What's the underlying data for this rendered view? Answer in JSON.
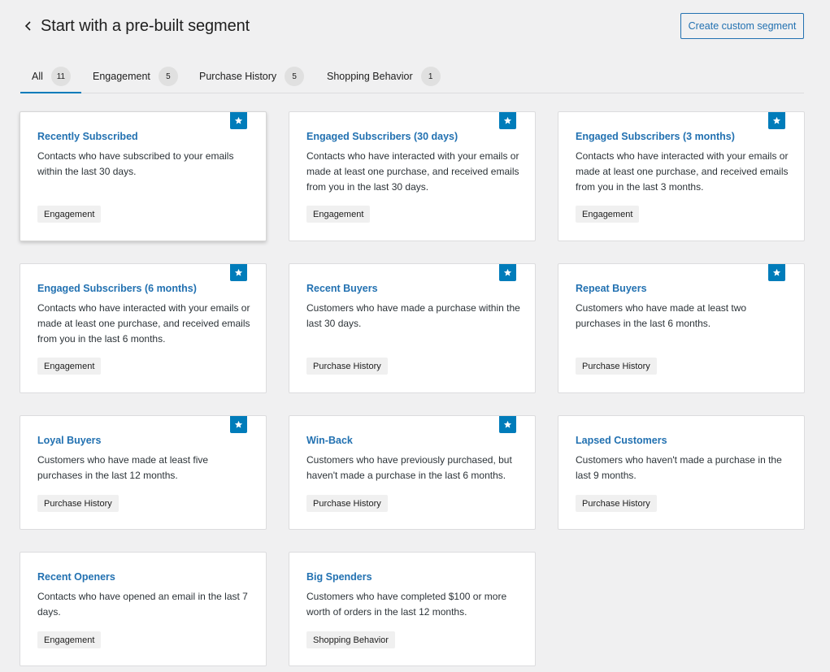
{
  "header": {
    "back_icon": "chevron-left-icon",
    "title": "Start with a pre-built segment",
    "create_button_label": "Create custom segment"
  },
  "tabs": [
    {
      "label": "All",
      "count": "11",
      "active": true
    },
    {
      "label": "Engagement",
      "count": "5",
      "active": false
    },
    {
      "label": "Purchase History",
      "count": "5",
      "active": false
    },
    {
      "label": "Shopping Behavior",
      "count": "1",
      "active": false
    }
  ],
  "colors": {
    "accent": "#007cba",
    "link": "#2271b1",
    "background": "#f0f0f1"
  },
  "segments": [
    {
      "title": "Recently Subscribed",
      "description": "Contacts who have subscribed to your emails within the last 30 days.",
      "tag": "Engagement",
      "featured": true,
      "icon": "star-icon"
    },
    {
      "title": "Engaged Subscribers (30 days)",
      "description": "Contacts who have interacted with your emails or made at least one purchase, and received emails from you in the last 30 days.",
      "tag": "Engagement",
      "featured": true,
      "icon": "star-icon"
    },
    {
      "title": "Engaged Subscribers (3 months)",
      "description": "Contacts who have interacted with your emails or made at least one purchase, and received emails from you in the last 3 months.",
      "tag": "Engagement",
      "featured": true,
      "icon": "star-icon"
    },
    {
      "title": "Engaged Subscribers (6 months)",
      "description": "Contacts who have interacted with your emails or made at least one purchase, and received emails from you in the last 6 months.",
      "tag": "Engagement",
      "featured": true,
      "icon": "star-icon"
    },
    {
      "title": "Recent Buyers",
      "description": "Customers who have made a purchase within the last 30 days.",
      "tag": "Purchase History",
      "featured": true,
      "icon": "star-icon"
    },
    {
      "title": "Repeat Buyers",
      "description": "Customers who have made at least two purchases in the last 6 months.",
      "tag": "Purchase History",
      "featured": true,
      "icon": "star-icon"
    },
    {
      "title": "Loyal Buyers",
      "description": "Customers who have made at least five purchases in the last 12 months.",
      "tag": "Purchase History",
      "featured": true,
      "icon": "star-icon"
    },
    {
      "title": "Win-Back",
      "description": "Customers who have previously purchased, but haven't made a purchase in the last 6 months.",
      "tag": "Purchase History",
      "featured": true,
      "icon": "star-icon"
    },
    {
      "title": "Lapsed Customers",
      "description": "Customers who haven't made a purchase in the last 9 months.",
      "tag": "Purchase History",
      "featured": false
    },
    {
      "title": "Recent Openers",
      "description": "Contacts who have opened an email in the last 7 days.",
      "tag": "Engagement",
      "featured": false
    },
    {
      "title": "Big Spenders",
      "description": "Customers who have completed $100 or more worth of orders in the last 12 months.",
      "tag": "Shopping Behavior",
      "featured": false
    }
  ]
}
